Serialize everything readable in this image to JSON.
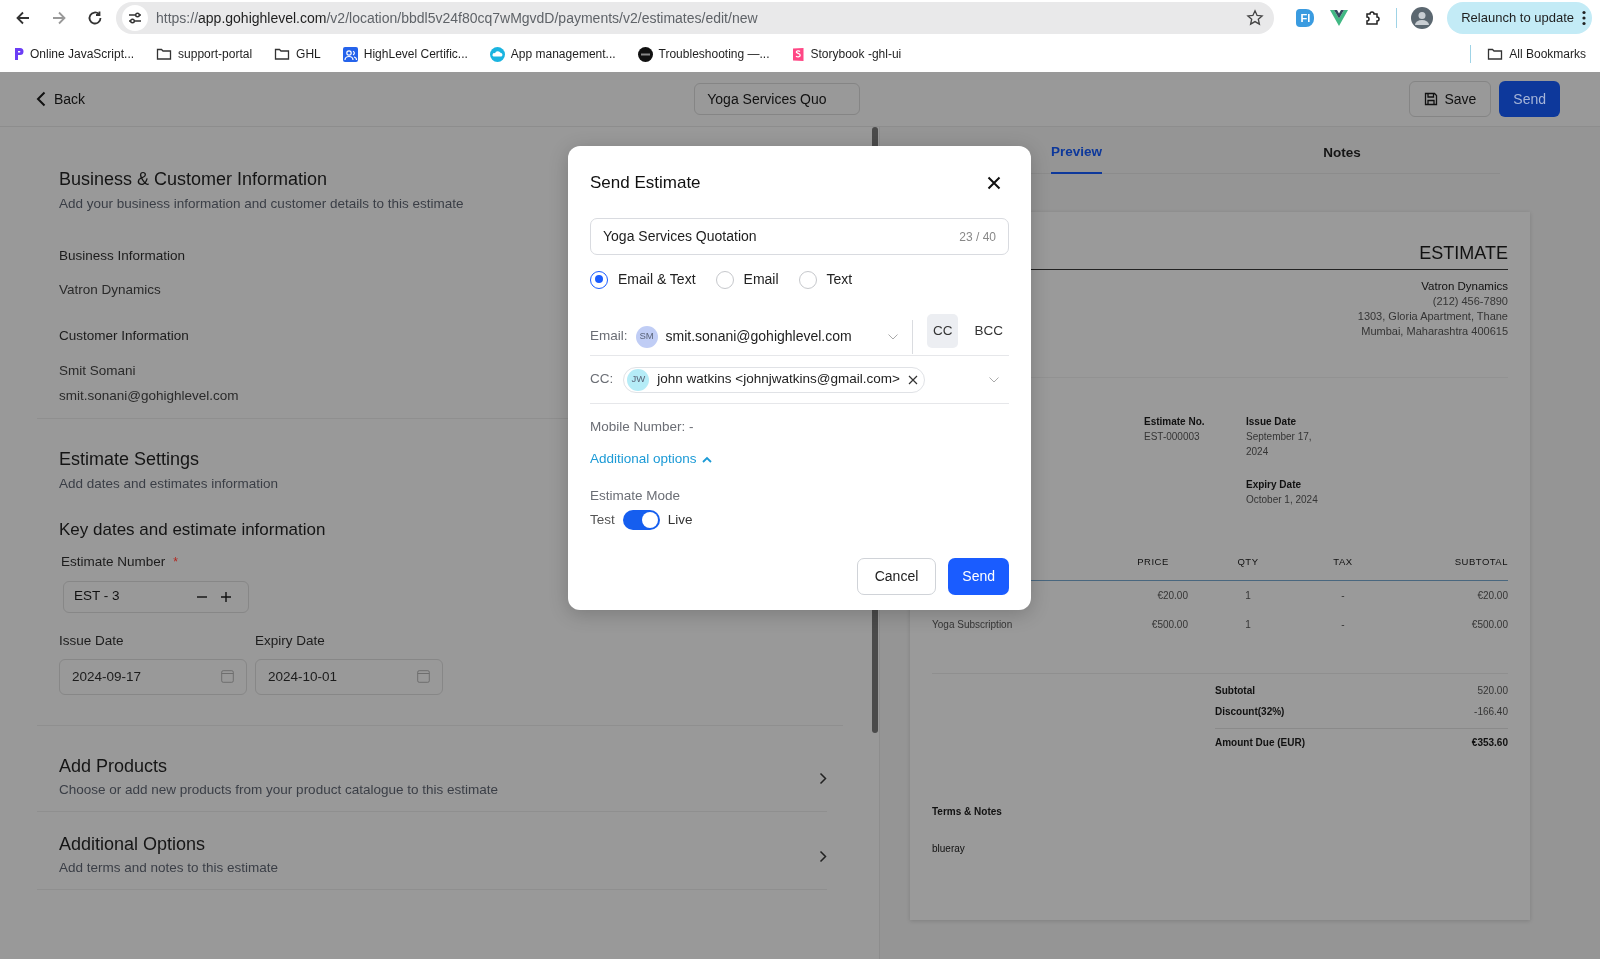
{
  "browser": {
    "url_scheme": "https://",
    "url_host": "app.gohighlevel.com",
    "url_path": "/v2/location/bbdl5v24f80cq7wMgvdD/payments/v2/estimates/edit/new",
    "extensions": [
      {
        "kind": "badge",
        "label": "FI"
      },
      {
        "kind": "vue"
      },
      {
        "kind": "puzzle"
      }
    ],
    "relaunch": "Relaunch to update",
    "bookmarks": [
      {
        "kind": "app",
        "label": "Online JavaScript..."
      },
      {
        "kind": "folder",
        "label": "support-portal"
      },
      {
        "kind": "folder",
        "label": "GHL"
      },
      {
        "kind": "team",
        "label": "HighLevel Certific..."
      },
      {
        "kind": "cloud",
        "label": "App management..."
      },
      {
        "kind": "dark",
        "label": "Troubleshooting —..."
      },
      {
        "kind": "storybook",
        "label": "Storybook -ghl-ui"
      }
    ],
    "all_bookmarks": "All Bookmarks"
  },
  "header": {
    "back": "Back",
    "title_value": "Yoga Services Quo",
    "save": "Save",
    "send": "Send"
  },
  "form": {
    "business": {
      "title": "Business & Customer Information",
      "subtitle": "Add your business information and customer details to this estimate",
      "business_label": "Business Information",
      "business_name": "Vatron Dynamics",
      "customer_label": "Customer Information",
      "customer_name": "Smit Somani",
      "customer_email": "smit.sonani@gohighlevel.com"
    },
    "settings": {
      "title": "Estimate Settings",
      "subtitle": "Add dates and estimates information",
      "group_title": "Key dates and estimate information",
      "number_label": "Estimate Number",
      "required_mark": "*",
      "number_value": "EST - 3",
      "issue_label": "Issue Date",
      "issue_value": "2024-09-17",
      "expiry_label": "Expiry Date",
      "expiry_value": "2024-10-01"
    },
    "collapsed": [
      {
        "title": "Add Products",
        "subtitle": "Choose or add new products from your product catalogue to this estimate"
      },
      {
        "title": "Additional Options",
        "subtitle": "Add terms and notes to this estimate"
      }
    ]
  },
  "preview": {
    "tabs": [
      {
        "label": "Preview",
        "selected": true
      },
      {
        "label": "Notes",
        "selected": false
      }
    ],
    "document": {
      "title": "ESTIMATE",
      "company": [
        "Vatron Dynamics",
        "(212) 456-7890",
        "1303, Gloria Apartment, Thane",
        "Mumbai, Maharashtra 400615"
      ],
      "info": [
        {
          "label": "Estimate No.",
          "value": "EST-000003"
        },
        {
          "label": "Issue Date",
          "value": "September 17, 2024"
        },
        {
          "label": "Expiry Date",
          "value": "October 1, 2024"
        }
      ],
      "columns": [
        "PRICE",
        "QTY",
        "TAX",
        "SUBTOTAL"
      ],
      "rows": [
        {
          "price": "€20.00",
          "qty": "1",
          "tax": "-",
          "subtotal": "€20.00"
        },
        {
          "item": "Yoga Subscription",
          "price": "€500.00",
          "qty": "1",
          "tax": "-",
          "subtotal": "€500.00"
        }
      ],
      "totals": [
        {
          "kind": "line",
          "label": "Subtotal",
          "value": "520.00"
        },
        {
          "kind": "line",
          "label": "Discount(32%)",
          "value": "-166.40"
        },
        {
          "kind": "due",
          "label": "Amount Due (EUR)",
          "value": "€353.60"
        }
      ],
      "terms_title": "Terms & Notes",
      "terms": "blueray"
    }
  },
  "modal": {
    "title": "Send Estimate",
    "name_value": "Yoga Services Quotation",
    "name_count": "23 / 40",
    "channels": [
      {
        "label": "Email & Text",
        "selected": true
      },
      {
        "label": "Email",
        "selected": false
      },
      {
        "label": "Text",
        "selected": false
      }
    ],
    "email_label": "Email:",
    "email_initials": "SM",
    "email_value": "smit.sonani@gohighlevel.com",
    "copy_toggles": [
      {
        "label": "CC",
        "selected": true
      },
      {
        "label": "BCC",
        "selected": false
      }
    ],
    "cc_label": "CC:",
    "cc_chips": [
      {
        "initials": "JW",
        "text": "john watkins <johnjwatkins@gmail.com>"
      }
    ],
    "mobile": "Mobile Number: -",
    "additional": {
      "label": "Additional options",
      "expanded": true
    },
    "mode_label": "Estimate Mode",
    "mode_off": "Test",
    "mode_on": "Live",
    "live": true,
    "cancel": "Cancel",
    "send": "Send"
  }
}
